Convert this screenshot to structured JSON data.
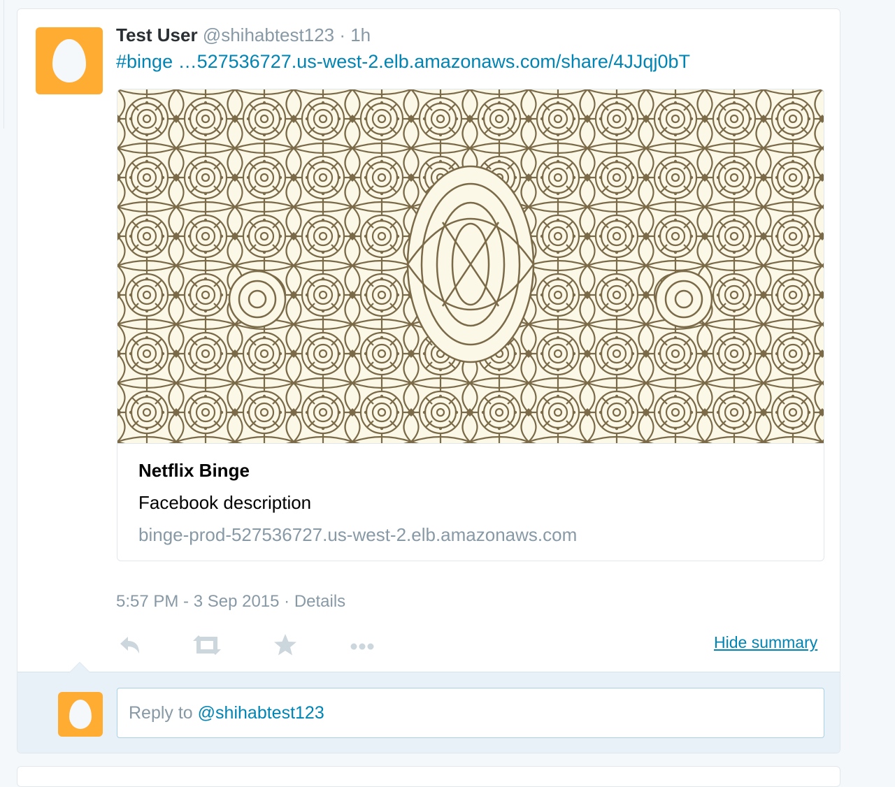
{
  "tweet": {
    "fullname": "Test User",
    "username": "@shihabtest123",
    "separator": " · ",
    "timestamp": "1h",
    "text": "#binge …527536727.us-west-2.elb.amazonaws.com/share/4JJqj0bT"
  },
  "card": {
    "title": "Netflix Binge",
    "description": "Facebook description",
    "domain": "binge-prod-527536727.us-west-2.elb.amazonaws.com"
  },
  "meta": {
    "datetime": "5:57 PM - 3 Sep 2015",
    "separator": " · ",
    "details_link": "Details"
  },
  "actions": {
    "reply_icon": "reply-icon",
    "retweet_icon": "retweet-icon",
    "favorite_icon": "star-icon",
    "more_icon": "more-icon",
    "hide_summary": "Hide summary"
  },
  "reply": {
    "placeholder_prefix": "Reply to ",
    "mention": "@shihabtest123"
  },
  "colors": {
    "link": "#0084b4",
    "muted": "#8899a6",
    "avatar": "#ffac33",
    "pattern_ink": "#7a6a48",
    "pattern_bg": "#fbf8e8"
  }
}
